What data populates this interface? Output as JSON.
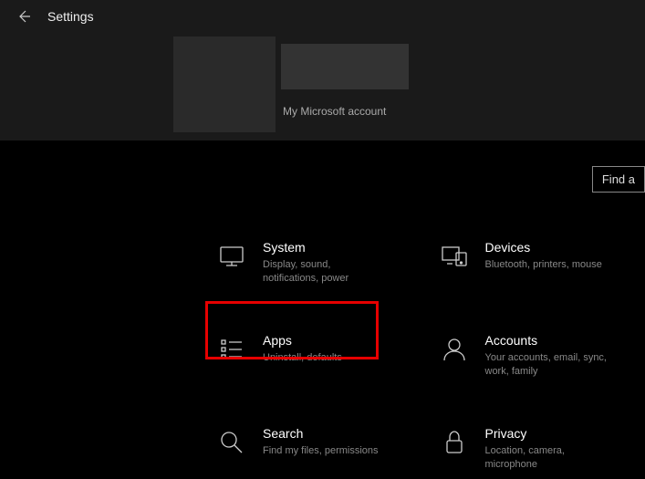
{
  "header": {
    "title": "Settings",
    "account_link": "My Microsoft account"
  },
  "search": {
    "placeholder": "Find a"
  },
  "categories": [
    {
      "title": "System",
      "desc": "Display, sound, notifications, power",
      "highlighted": false
    },
    {
      "title": "Devices",
      "desc": "Bluetooth, printers, mouse",
      "highlighted": false
    },
    {
      "title": "Apps",
      "desc": "Uninstall, defaults",
      "highlighted": true
    },
    {
      "title": "Accounts",
      "desc": "Your accounts, email, sync, work, family",
      "highlighted": false
    },
    {
      "title": "Search",
      "desc": "Find my files, permissions",
      "highlighted": false
    },
    {
      "title": "Privacy",
      "desc": "Location, camera, microphone",
      "highlighted": false
    }
  ]
}
